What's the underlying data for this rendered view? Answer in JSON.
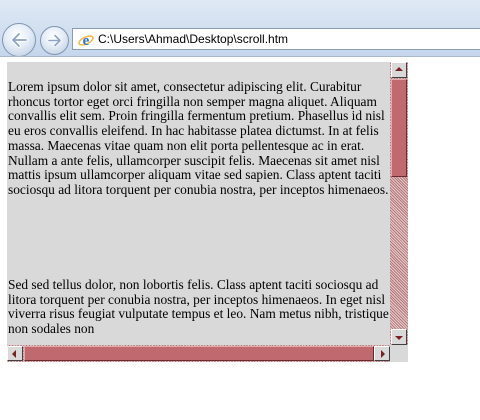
{
  "browser": {
    "address_url": "C:\\Users\\Ahmad\\Desktop\\scroll.htm",
    "back_icon": "back-arrow-icon",
    "forward_icon": "forward-arrow-icon",
    "page_icon": "ie-logo-icon"
  },
  "page": {
    "paragraphs": [
      "Lorem ipsum dolor sit amet, consectetur adipiscing elit. Curabitur rhoncus tortor eget orci fringilla non semper magna aliquet. Aliquam convallis elit sem. Proin fringilla fermentum pretium. Phasellus id nisl eu eros convallis eleifend. In hac habitasse platea dictumst. In at felis massa. Maecenas vitae quam non elit porta pellentesque ac in erat. Nullam a ante felis, ullamcorper suscipit felis. Maecenas sit amet nisl mattis ipsum ullamcorper aliquam vitae sed sapien. Class aptent taciti sociosqu ad litora torquent per conubia nostra, per inceptos himenaeos.",
      "Sed sed tellus dolor, non lobortis felis. Class aptent taciti sociosqu ad litora torquent per conubia nostra, per inceptos himenaeos. In eget nisl viverra risus feugiat vulputate tempus et leo. Nam metus nibh, tristique non sodales non"
    ]
  },
  "scrollbars": {
    "thumb_color": "#c0696e",
    "track_color": "#c9999b",
    "arrow_color": "#7a1f24",
    "vertical_position": 0.0,
    "horizontal_position": 0.0
  }
}
